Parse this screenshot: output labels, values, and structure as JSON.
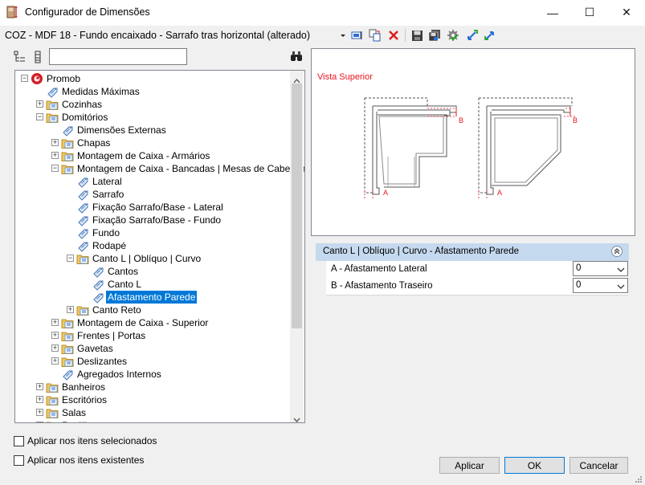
{
  "window": {
    "title": "Configurador de Dimensões",
    "controls": {
      "minimize": "—",
      "maximize": "☐",
      "close": "✕"
    }
  },
  "toolbar": {
    "config_name": "COZ - MDF 18 - Fundo encaixado - Sarrafo tras horizontal (alterado)",
    "icons": [
      "dropdown-arrow-icon",
      "insert-icon",
      "copy-icon",
      "delete-icon",
      "save-icon",
      "save-as-icon",
      "settings-icon",
      "import-icon",
      "export-icon"
    ]
  },
  "search": {
    "value": "",
    "placeholder": ""
  },
  "tree": {
    "items": [
      {
        "label": "Promob",
        "level": 0,
        "expander": "−",
        "icon": "promob-logo-icon"
      },
      {
        "label": "Medidas Máximas",
        "level": 1,
        "expander": "",
        "icon": "tag-icon"
      },
      {
        "label": "Cozinhas",
        "level": 1,
        "expander": "+",
        "icon": "folder-icon"
      },
      {
        "label": "Domitórios",
        "level": 1,
        "expander": "−",
        "icon": "folder-icon"
      },
      {
        "label": "Dimensões Externas",
        "level": 2,
        "expander": "",
        "icon": "tag-icon"
      },
      {
        "label": "Chapas",
        "level": 2,
        "expander": "+",
        "icon": "folder-icon"
      },
      {
        "label": "Montagem de Caixa - Armários",
        "level": 2,
        "expander": "+",
        "icon": "folder-icon"
      },
      {
        "label": "Montagem de Caixa - Bancadas | Mesas de Cabeceira",
        "level": 2,
        "expander": "−",
        "icon": "folder-icon"
      },
      {
        "label": "Lateral",
        "level": 3,
        "expander": "",
        "icon": "tag-icon"
      },
      {
        "label": "Sarrafo",
        "level": 3,
        "expander": "",
        "icon": "tag-icon"
      },
      {
        "label": "Fixação Sarrafo/Base - Lateral",
        "level": 3,
        "expander": "",
        "icon": "tag-icon"
      },
      {
        "label": "Fixação Sarrafo/Base - Fundo",
        "level": 3,
        "expander": "",
        "icon": "tag-icon"
      },
      {
        "label": "Fundo",
        "level": 3,
        "expander": "",
        "icon": "tag-icon"
      },
      {
        "label": "Rodapé",
        "level": 3,
        "expander": "",
        "icon": "tag-icon"
      },
      {
        "label": "Canto L | Oblíquo | Curvo",
        "level": 3,
        "expander": "−",
        "icon": "folder-icon"
      },
      {
        "label": "Cantos",
        "level": 4,
        "expander": "",
        "icon": "tag-icon"
      },
      {
        "label": "Canto L",
        "level": 4,
        "expander": "",
        "icon": "tag-icon"
      },
      {
        "label": "Afastamento Parede",
        "level": 4,
        "expander": "",
        "icon": "tag-icon",
        "selected": true
      },
      {
        "label": "Canto Reto",
        "level": 3,
        "expander": "+",
        "icon": "folder-icon"
      },
      {
        "label": "Montagem de Caixa - Superior",
        "level": 2,
        "expander": "+",
        "icon": "folder-icon"
      },
      {
        "label": "Frentes | Portas",
        "level": 2,
        "expander": "+",
        "icon": "folder-icon"
      },
      {
        "label": "Gavetas",
        "level": 2,
        "expander": "+",
        "icon": "folder-icon"
      },
      {
        "label": "Deslizantes",
        "level": 2,
        "expander": "+",
        "icon": "folder-icon"
      },
      {
        "label": "Agregados Internos",
        "level": 2,
        "expander": "",
        "icon": "tag-icon"
      },
      {
        "label": "Banheiros",
        "level": 1,
        "expander": "+",
        "icon": "folder-icon"
      },
      {
        "label": "Escritórios",
        "level": 1,
        "expander": "+",
        "icon": "folder-icon"
      },
      {
        "label": "Salas",
        "level": 1,
        "expander": "+",
        "icon": "folder-icon"
      },
      {
        "label": "Rotúlio",
        "level": 1,
        "expander": "+",
        "icon": "folder-icon"
      }
    ]
  },
  "preview": {
    "caption": "Vista Superior",
    "label_a": "A",
    "label_b": "B",
    "caption_color": "#e8141e"
  },
  "properties": {
    "group_title": "Canto L | Oblíquo | Curvo - Afastamento Parede",
    "collapse_glyph": "«",
    "rows": [
      {
        "label": "A - Afastamento Lateral",
        "value": "0"
      },
      {
        "label": "B - Afastamento Traseiro",
        "value": "0"
      }
    ]
  },
  "options": {
    "apply_selected": "Aplicar nos itens selecionados",
    "apply_existing": "Aplicar nos itens existentes"
  },
  "buttons": {
    "apply": "Aplicar",
    "ok": "OK",
    "cancel": "Cancelar"
  },
  "colors": {
    "selection": "#0078d7",
    "group_header": "#c5d9ef",
    "accent_red": "#e8141e"
  }
}
